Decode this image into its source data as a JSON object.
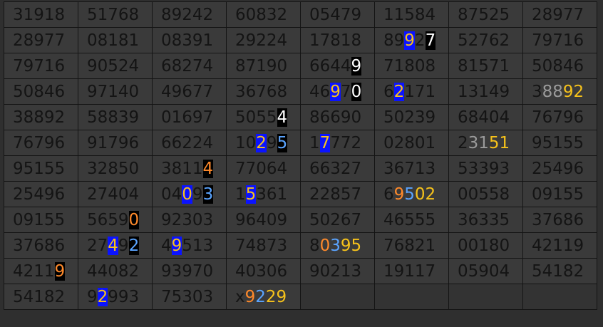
{
  "rows": [
    [
      "31918",
      "51768",
      "89242",
      "60832",
      "05479",
      "11584",
      "87525",
      "28977"
    ],
    [
      "28977",
      "08181",
      "08391",
      "29224",
      "17818",
      "89927",
      "52762",
      "79716"
    ],
    [
      "79716",
      "90524",
      "68274",
      "87190",
      "66449",
      "71808",
      "81571",
      "50846"
    ],
    [
      "50846",
      "97140",
      "49677",
      "36768",
      "46970",
      "62171",
      "13149",
      "38892"
    ],
    [
      "38892",
      "58839",
      "01697",
      "50554",
      "86690",
      "50239",
      "68404",
      "76796"
    ],
    [
      "76796",
      "91796",
      "66224",
      "10295",
      "17772",
      "02801",
      "23151",
      "95155"
    ],
    [
      "95155",
      "32850",
      "38114",
      "77064",
      "66327",
      "36713",
      "53393",
      "25496"
    ],
    [
      "25496",
      "27404",
      "04093",
      "15361",
      "22857",
      "69502",
      "00558",
      "09155"
    ],
    [
      "09155",
      "56590",
      "92303",
      "96409",
      "50267",
      "46555",
      "36335",
      "37686"
    ],
    [
      "37686",
      "27492",
      "49513",
      "74873",
      "80395",
      "76821",
      "00180",
      "42119"
    ],
    [
      "42119",
      "44082",
      "93970",
      "40306",
      "90213",
      "19117",
      "05904",
      "54182"
    ],
    [
      "54182",
      "92993",
      "75303",
      "x9229",
      "",
      "",
      "",
      ""
    ]
  ],
  "highlights": [
    {
      "r": 1,
      "c": 5,
      "spans": [
        [
          "89",
          ""
        ],
        [
          "9",
          "hl-blue"
        ],
        [
          "2",
          ""
        ],
        [
          "7",
          "hl-black"
        ]
      ]
    },
    {
      "r": 2,
      "c": 4,
      "spans": [
        [
          "6644",
          ""
        ],
        [
          "9",
          "hl-black"
        ]
      ]
    },
    {
      "r": 3,
      "c": 4,
      "spans": [
        [
          "46",
          ""
        ],
        [
          "9",
          "hl-blue"
        ],
        [
          "7",
          ""
        ],
        [
          "0",
          "hl-black"
        ]
      ]
    },
    {
      "r": 3,
      "c": 5,
      "spans": [
        [
          "6",
          ""
        ],
        [
          "2",
          "hl-blue"
        ],
        [
          "171",
          ""
        ]
      ]
    },
    {
      "r": 3,
      "c": 7,
      "spans": [
        [
          "3",
          ""
        ],
        [
          "88",
          "c-gray"
        ],
        [
          "92",
          "c-yellow"
        ]
      ]
    },
    {
      "r": 4,
      "c": 3,
      "spans": [
        [
          "5055",
          ""
        ],
        [
          "4",
          "hl-black"
        ]
      ]
    },
    {
      "r": 5,
      "c": 3,
      "spans": [
        [
          "10",
          ""
        ],
        [
          "2",
          "hl-blue"
        ],
        [
          "9",
          ""
        ],
        [
          "5",
          "hl-black c-ltblue"
        ]
      ]
    },
    {
      "r": 5,
      "c": 4,
      "spans": [
        [
          "1",
          ""
        ],
        [
          "7",
          "hl-blue"
        ],
        [
          "772",
          ""
        ]
      ]
    },
    {
      "r": 5,
      "c": 6,
      "spans": [
        [
          "2",
          ""
        ],
        [
          "31",
          "c-gray"
        ],
        [
          "51",
          "c-yellow"
        ]
      ]
    },
    {
      "r": 6,
      "c": 2,
      "spans": [
        [
          "3811",
          ""
        ],
        [
          "4",
          "hl-black c-orange"
        ]
      ]
    },
    {
      "r": 7,
      "c": 2,
      "spans": [
        [
          "04",
          ""
        ],
        [
          "0",
          "hl-blue"
        ],
        [
          "9",
          ""
        ],
        [
          "3",
          "hl-black c-ltblue"
        ]
      ]
    },
    {
      "r": 7,
      "c": 3,
      "spans": [
        [
          "1",
          ""
        ],
        [
          "5",
          "hl-blue"
        ],
        [
          "361",
          ""
        ]
      ]
    },
    {
      "r": 7,
      "c": 5,
      "spans": [
        [
          "6",
          ""
        ],
        [
          "9",
          "c-orange"
        ],
        [
          "5",
          "c-ltblue"
        ],
        [
          "02",
          "c-yellow"
        ]
      ]
    },
    {
      "r": 8,
      "c": 1,
      "spans": [
        [
          "5659",
          ""
        ],
        [
          "0",
          "hl-black c-orange"
        ]
      ]
    },
    {
      "r": 9,
      "c": 1,
      "spans": [
        [
          "27",
          ""
        ],
        [
          "4",
          "hl-blue"
        ],
        [
          "9",
          ""
        ],
        [
          "2",
          "hl-black c-ltblue"
        ]
      ]
    },
    {
      "r": 9,
      "c": 2,
      "spans": [
        [
          "4",
          ""
        ],
        [
          "9",
          "hl-blue"
        ],
        [
          "513",
          ""
        ]
      ]
    },
    {
      "r": 9,
      "c": 4,
      "spans": [
        [
          "8",
          ""
        ],
        [
          "0",
          "c-orange"
        ],
        [
          "3",
          "c-ltblue"
        ],
        [
          "95",
          "c-yellow"
        ]
      ]
    },
    {
      "r": 10,
      "c": 0,
      "spans": [
        [
          "4211",
          ""
        ],
        [
          "9",
          "hl-black c-orange"
        ]
      ]
    },
    {
      "r": 11,
      "c": 1,
      "spans": [
        [
          "9",
          ""
        ],
        [
          "2",
          "hl-blue"
        ],
        [
          "993",
          ""
        ]
      ]
    },
    {
      "r": 11,
      "c": 3,
      "spans": [
        [
          "x",
          ""
        ],
        [
          "9",
          "c-orange"
        ],
        [
          "2",
          "c-ltblue"
        ],
        [
          "29",
          "c-yellow"
        ]
      ]
    }
  ],
  "colors": {
    "blue_highlight": "#0b13ff",
    "black_highlight": "#000000",
    "orange": "#ff8a2b",
    "yellow": "#f6c21b",
    "light_blue": "#5aa4ff",
    "gray": "#9a9a9a",
    "cell_bg": "#3a3a3a",
    "text": "#141414"
  }
}
